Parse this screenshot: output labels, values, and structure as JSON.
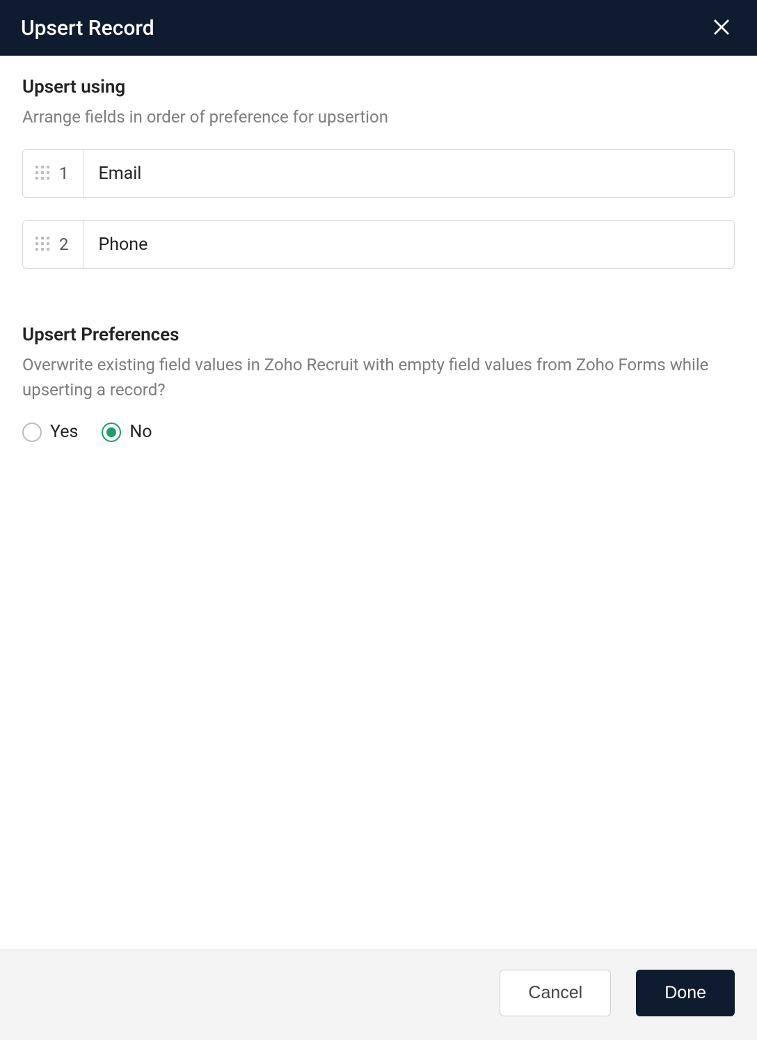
{
  "header": {
    "title": "Upsert Record"
  },
  "upsert_using": {
    "title": "Upsert using",
    "description": "Arrange fields in order of preference for upsertion",
    "fields": [
      {
        "order": "1",
        "label": "Email"
      },
      {
        "order": "2",
        "label": "Phone"
      }
    ]
  },
  "upsert_preferences": {
    "title": "Upsert Preferences",
    "description": "Overwrite existing field values in Zoho Recruit with empty field values from Zoho Forms while upserting a record?",
    "options": {
      "yes": "Yes",
      "no": "No"
    },
    "selected": "no"
  },
  "footer": {
    "cancel": "Cancel",
    "done": "Done"
  }
}
